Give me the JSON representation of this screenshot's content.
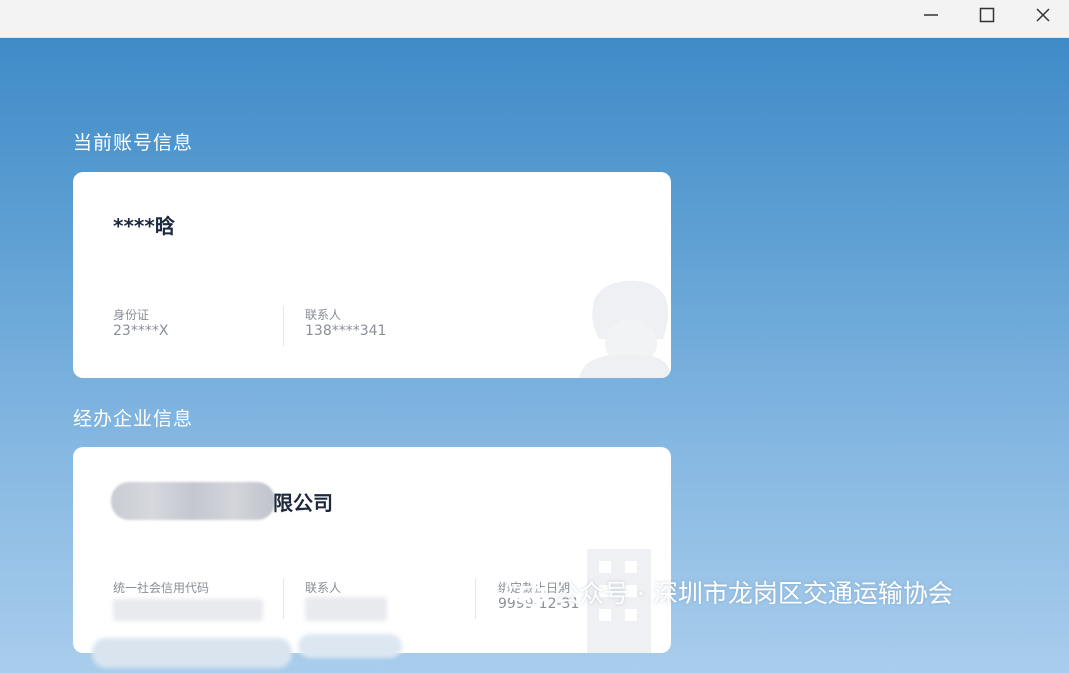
{
  "window": {
    "controls": {
      "minimize": "minimize-icon",
      "maximize": "maximize-icon",
      "close": "close-icon"
    }
  },
  "account": {
    "section_title": "当前账号信息",
    "name": "****晗",
    "id_label": "身份证",
    "id_value": "23****X",
    "contact_label": "联系人",
    "contact_value": "138****341"
  },
  "company": {
    "section_title": "经办企业信息",
    "name_visible_suffix": "限公司",
    "credit_code_label": "统一社会信用代码",
    "contact_label": "联系人",
    "bind_deadline_label": "绑定截止日期",
    "bind_deadline_value": "9999-12-31"
  },
  "watermark": {
    "text": "公众号 · 深圳市龙岗区交通运输协会",
    "icon": "wechat-icon"
  },
  "colors": {
    "accent": "#3f8bc8",
    "card_bg": "#ffffff",
    "title_text": "#1d2a3e"
  }
}
